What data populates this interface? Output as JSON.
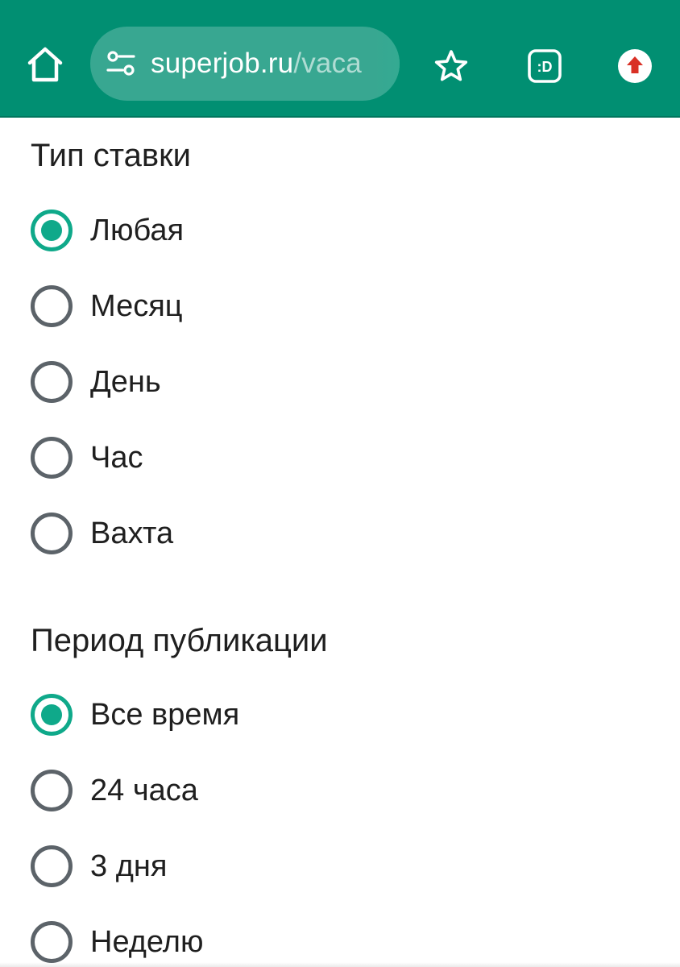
{
  "browser": {
    "url_host": "superjob.ru",
    "url_path": "/vaca",
    "colors": {
      "toolbar": "#018f72",
      "accent": "#0fa98a",
      "update_badge": "#d93025"
    },
    "icons": {
      "home": "home-icon",
      "site_settings": "tune-icon",
      "bookmark": "star-icon",
      "extension": "extension-face-icon",
      "update": "update-arrow-icon"
    },
    "extension_label": ":D"
  },
  "filters": {
    "rate_type": {
      "title": "Тип ставки",
      "selected": "Любая",
      "options": [
        "Любая",
        "Месяц",
        "День",
        "Час",
        "Вахта"
      ]
    },
    "publication_period": {
      "title": "Период публикации",
      "selected": "Все время",
      "options": [
        "Все время",
        "24 часа",
        "3 дня",
        "Неделю"
      ]
    }
  }
}
